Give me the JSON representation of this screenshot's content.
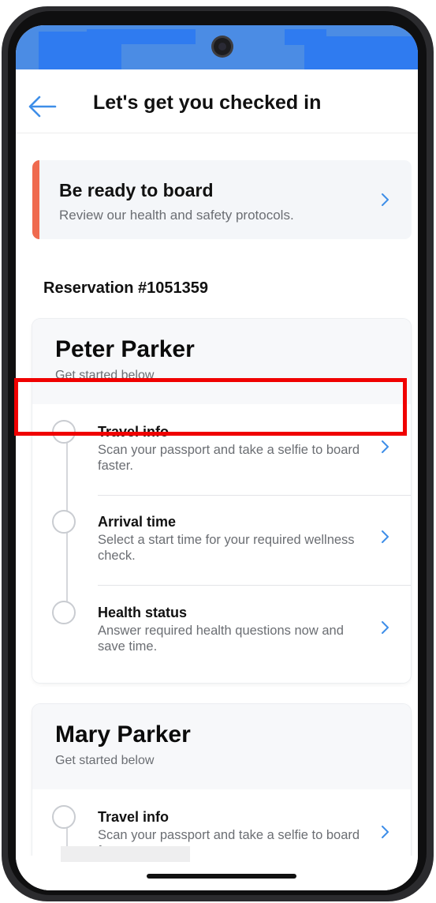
{
  "header": {
    "title": "Let's get you checked in"
  },
  "banner": {
    "title": "Be ready to board",
    "subtitle": "Review our health and safety protocols."
  },
  "reservation": {
    "label": "Reservation #1051359"
  },
  "guests": [
    {
      "name": "Peter Parker",
      "subtitle": "Get started below",
      "steps": [
        {
          "title": "Travel info",
          "description": "Scan your passport and take a selfie to board faster."
        },
        {
          "title": "Arrival time",
          "description": "Select a start time for your required wellness check."
        },
        {
          "title": "Health status",
          "description": "Answer required health questions now and save time."
        }
      ]
    },
    {
      "name": "Mary Parker",
      "subtitle": "Get started below",
      "steps": [
        {
          "title": "Travel info",
          "description": "Scan your passport and take a selfie to board faster."
        }
      ]
    }
  ],
  "colors": {
    "accent_banner": "#ef6a4f",
    "link_blue": "#3e8ee8",
    "highlight_red": "#f00000",
    "status_bar_blue": "#4b8ce4"
  },
  "icons": {
    "back": "arrow-left-icon",
    "row_chevron": "chevron-right-icon",
    "step_marker": "circle-outline-icon"
  }
}
